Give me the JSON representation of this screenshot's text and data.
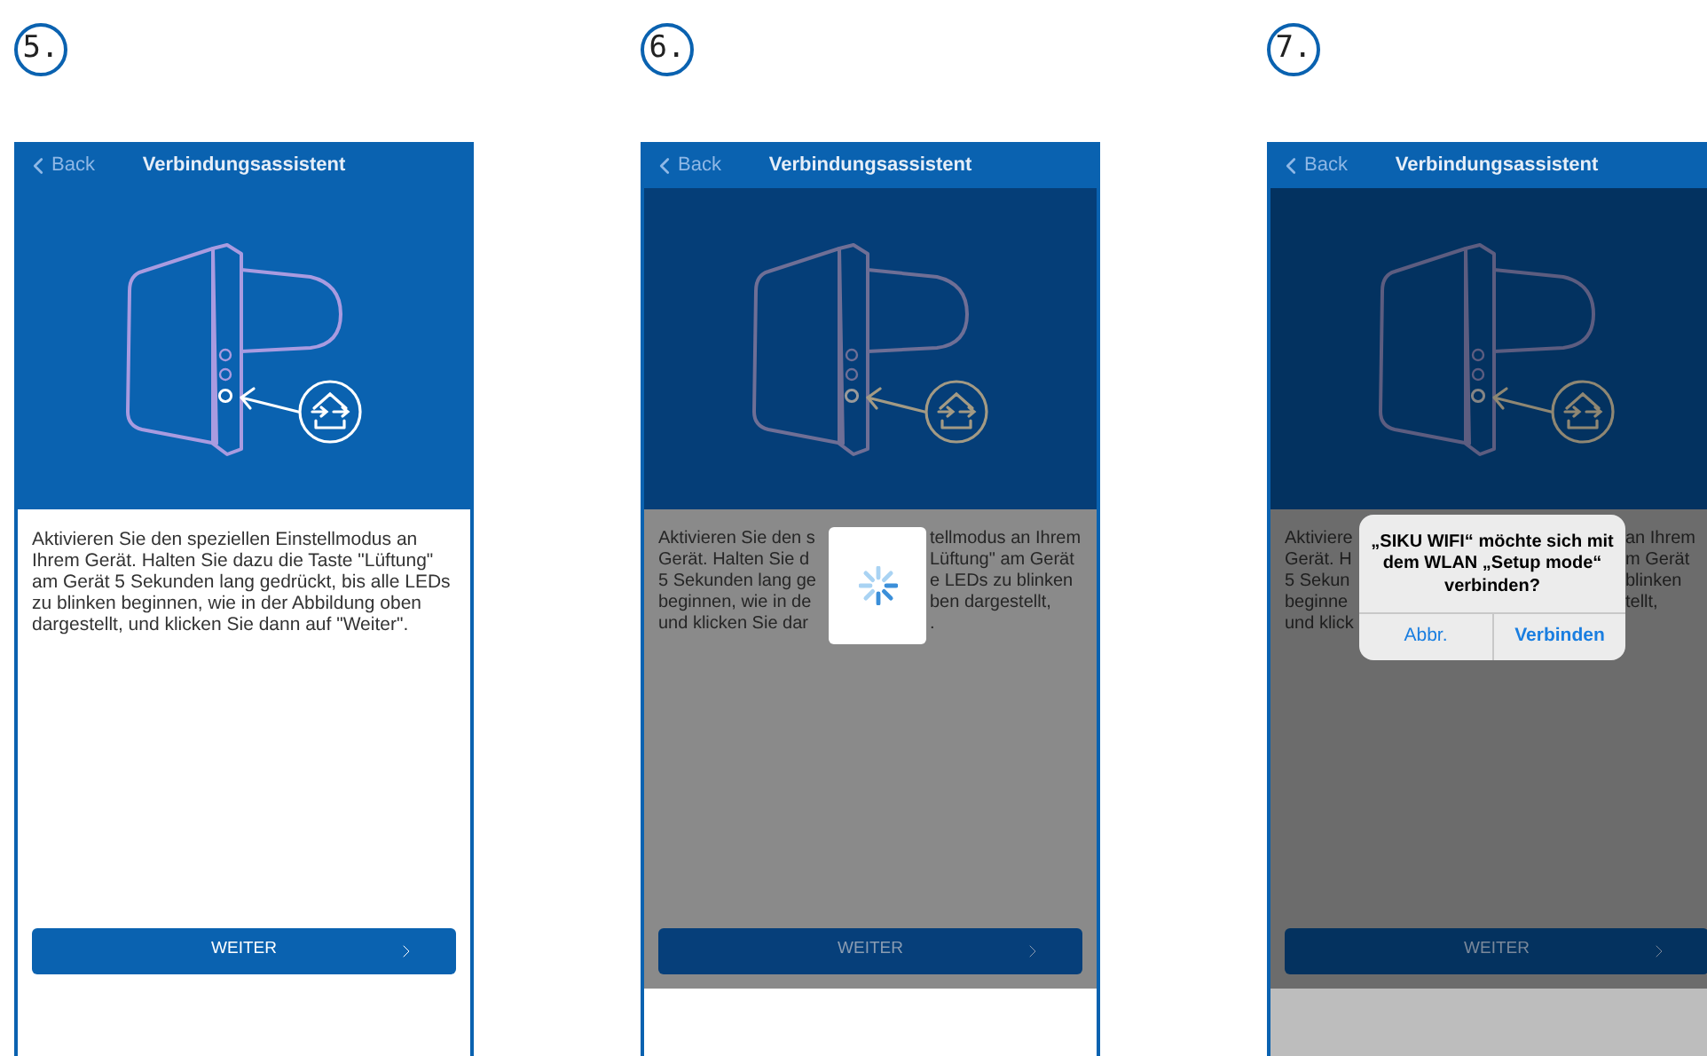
{
  "steps": [
    {
      "number": "5.",
      "screen": {
        "kind": "plain",
        "back": "Back",
        "title": "Verbindungsassistent",
        "paragraph": "Aktivieren Sie den speziellen Einstellmodus an Ihrem Gerät. Halten Sie dazu die Taste \"Lüftung\" am Gerät 5 Sekunden lang gedrückt, bis alle LEDs zu blinken beginnen, wie in der Abbildung oben dargestellt, und klicken Sie dann auf \"Weiter\".",
        "button": "WEITER"
      }
    },
    {
      "number": "6.",
      "screen": {
        "kind": "loading",
        "back": "Back",
        "title": "Verbindungsassistent",
        "lines": [
          {
            "left": "Aktivieren Sie den s",
            "right": "tellmodus an Ihrem"
          },
          {
            "left": "Gerät. Halten Sie d",
            "right": "Lüftung\" am Gerät"
          },
          {
            "left": "5 Sekunden lang ge",
            "right": "e LEDs zu blinken"
          },
          {
            "left": "beginnen, wie in de",
            "right": "ben dargestellt,"
          },
          {
            "left": "und klicken Sie dar",
            "right": "."
          }
        ],
        "button": "WEITER"
      }
    },
    {
      "number": "7.",
      "screen": {
        "kind": "alert",
        "back": "Back",
        "title": "Verbindungsassistent",
        "lines": [
          {
            "left": "Aktiviere",
            "right": "an Ihrem"
          },
          {
            "left": "Gerät. H",
            "right": "m Gerät"
          },
          {
            "left": "5 Sekun",
            "right": "blinken"
          },
          {
            "left": "beginne",
            "right": "tellt,"
          },
          {
            "left": "und klick"
          }
        ],
        "button": "WEITER",
        "alert": {
          "message": "„SIKU WIFI“ möchte sich mit dem WLAN „Setup mode“ verbinden?",
          "buttons": [
            "Abbr.",
            "Verbinden"
          ]
        }
      }
    }
  ]
}
